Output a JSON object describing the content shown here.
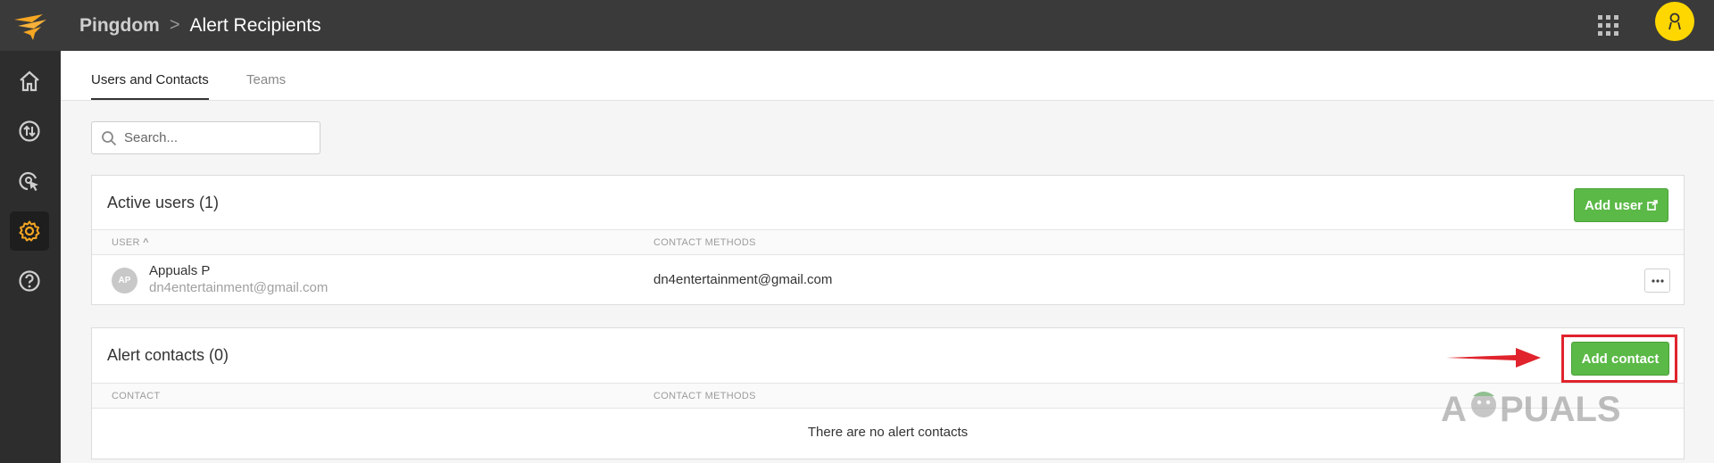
{
  "topbar": {
    "app_name": "Pingdom",
    "separator": ">",
    "page_title": "Alert Recipients"
  },
  "sidebar": {
    "items": [
      {
        "name": "home",
        "icon": "home-icon",
        "active": false
      },
      {
        "name": "transfer",
        "icon": "transfer-icon",
        "active": false
      },
      {
        "name": "monitoring",
        "icon": "monitoring-icon",
        "active": false
      },
      {
        "name": "settings",
        "icon": "gear-icon",
        "active": true
      },
      {
        "name": "help",
        "icon": "help-icon",
        "active": false
      }
    ]
  },
  "tabs": [
    {
      "label": "Users and Contacts",
      "active": true
    },
    {
      "label": "Teams",
      "active": false
    }
  ],
  "search": {
    "placeholder": "Search..."
  },
  "active_users": {
    "title": "Active users (1)",
    "add_button": "Add user",
    "columns": {
      "user": "USER",
      "sort_indicator": "^",
      "contact_methods": "CONTACT METHODS"
    },
    "rows": [
      {
        "initials": "AP",
        "name": "Appuals P",
        "email": "dn4entertainment@gmail.com",
        "contact_method": "dn4entertainment@gmail.com"
      }
    ]
  },
  "alert_contacts": {
    "title": "Alert contacts (0)",
    "add_button": "Add contact",
    "columns": {
      "contact": "CONTACT",
      "contact_methods": "CONTACT METHODS"
    },
    "empty_message": "There are no alert contacts"
  },
  "watermark": "APPUALS",
  "colors": {
    "topbar": "#3a3a3a",
    "sidebar": "#2d2d2d",
    "accent_orange": "#f5a623",
    "green_button": "#5bb947",
    "highlight_red": "#e0232c",
    "avatar_yellow": "#ffd700"
  }
}
